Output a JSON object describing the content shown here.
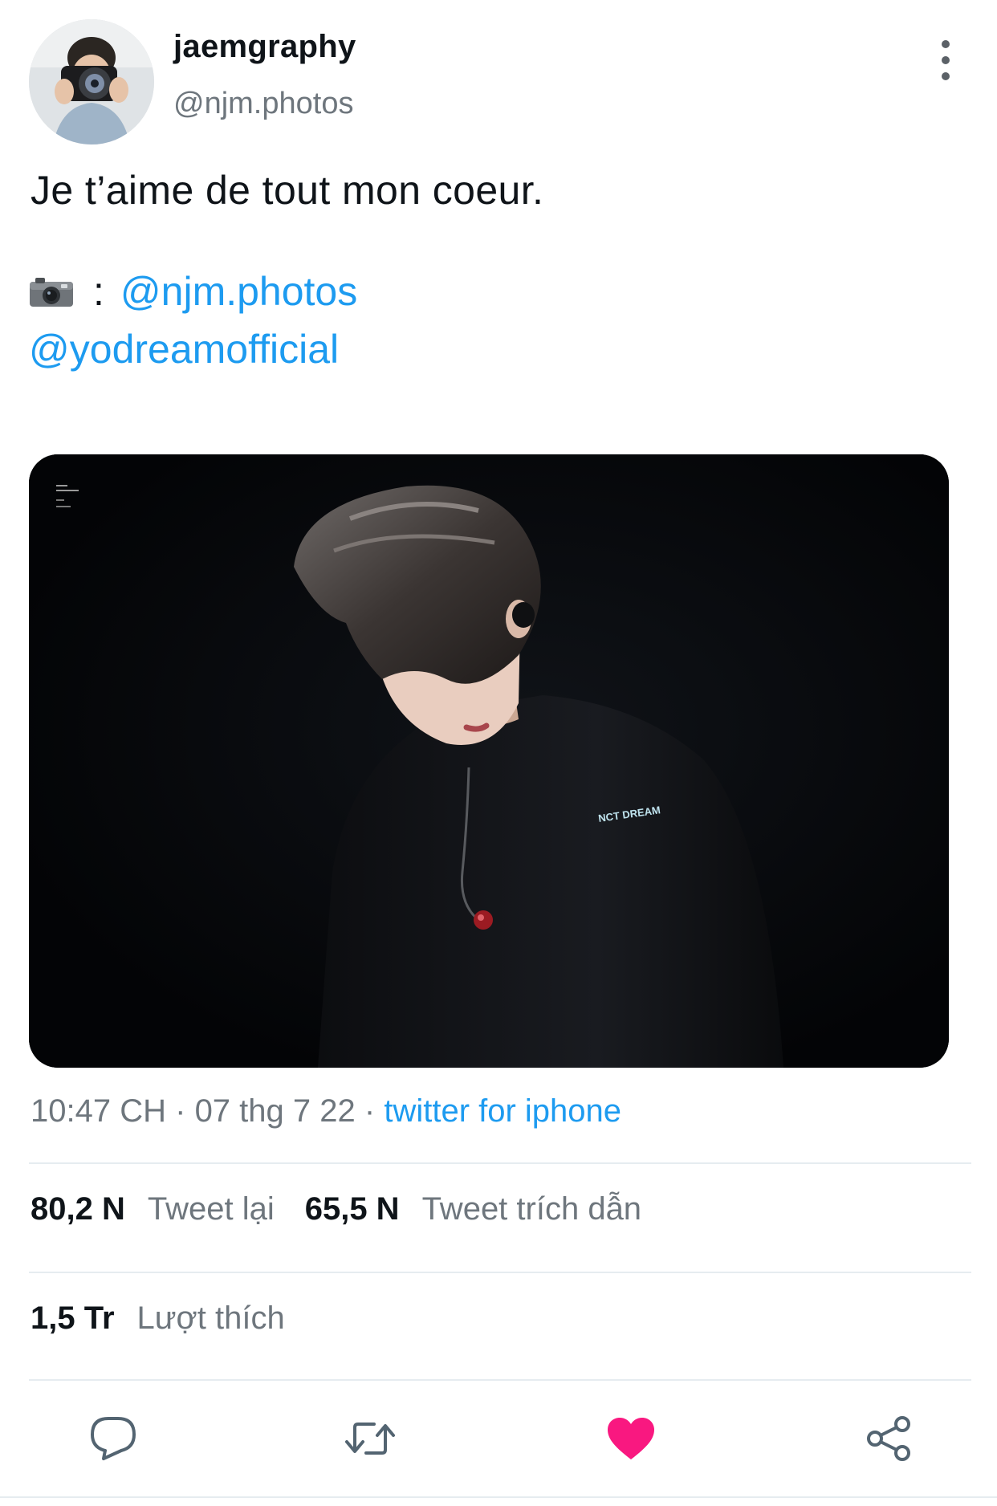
{
  "author": {
    "display_name": "jaemgraphy",
    "handle": "@njm.photos"
  },
  "tweet": {
    "text": "Je t’aime de tout mon coeur.",
    "credit_separator": ":",
    "mentions": [
      "@njm.photos",
      "@yodreamofficial"
    ],
    "media_text": {
      "shirt": "NCT DREAM"
    }
  },
  "meta": {
    "time": "10:47 CH",
    "separator": "·",
    "date": "07 thg 7 22",
    "source": "twitter for iphone"
  },
  "stats": {
    "retweets": {
      "count": "80,2 N",
      "label": "Tweet lại"
    },
    "quotes": {
      "count": "65,5 N",
      "label": "Tweet trích dẫn"
    },
    "likes": {
      "count": "1,5 Tr",
      "label": "Lượt thích"
    }
  },
  "actions": {
    "reply_icon": "reply-icon",
    "retweet_icon": "retweet-icon",
    "like_icon": "heart-icon",
    "like_active": true,
    "share_icon": "share-icon"
  },
  "colors": {
    "link": "#1d9bf0",
    "like": "#f91880",
    "secondary_text": "#6e767d",
    "divider": "#e6ecf0"
  }
}
